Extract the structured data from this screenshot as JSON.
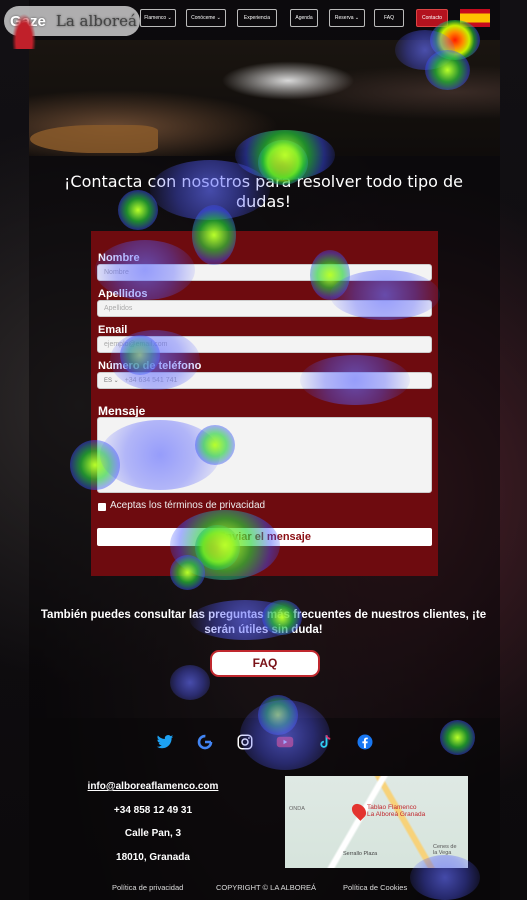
{
  "overlay": {
    "brand": "Gaze",
    "sub": "La alboreá"
  },
  "nav": {
    "items": [
      "Flamenco ⌄",
      "Conóceme ⌄",
      "Experiencia",
      "Agenda",
      "Reserva ⌄",
      "FAQ",
      "Contacto"
    ]
  },
  "heading": "¡Contacta con nosotros para resolver todo tipo de dudas!",
  "form": {
    "nombre_label": "Nombre",
    "nombre_placeholder": "Nombre",
    "apellidos_label": "Apellidos",
    "apellidos_placeholder": "Apellidos",
    "email_label": "Email",
    "email_placeholder": "ejemplo@email.com",
    "phone_label": "Número de teléfono",
    "phone_code": "ES ⌄",
    "phone_placeholder": "+34 634 541 741",
    "message_label": "Mensaje",
    "privacy_label": "Aceptas los términos de privacidad",
    "send_label": "Enviar el mensaje"
  },
  "faq_text": "También puedes consultar las preguntas más frecuentes de nuestros clientes, ¡te serán útiles sin duda!",
  "faq_button": "FAQ",
  "footer": {
    "email": "info@alboreaflamenco.com",
    "phone": "+34 858 12 49 31",
    "address1": "Calle Pan, 3",
    "address2": "18010, Granada",
    "privacy": "Política de privacidad",
    "copyright": "COPYRIGHT © LA ALBOREÁ",
    "cookies": "Política de Cookies"
  },
  "map": {
    "place": "Tablao Flamenco\nLa Alboreá Granada",
    "area1": "Cenes de\nla Vega",
    "area2": "ONDA",
    "area3": "Serrallo Plaza"
  },
  "social_icons": [
    "twitter-icon",
    "google-icon",
    "instagram-icon",
    "youtube-icon",
    "tiktok-icon",
    "facebook-icon"
  ],
  "colors": {
    "accent": "#b3121e",
    "form_bg": "#6e0b0f",
    "text": "#ffffff"
  }
}
